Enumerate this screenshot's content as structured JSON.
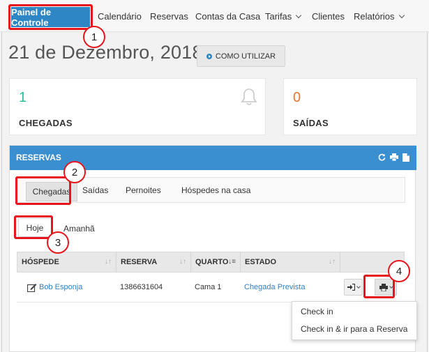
{
  "nav": {
    "active": "Painel de Controle",
    "items": [
      {
        "label": "Calendário"
      },
      {
        "label": "Reservas"
      },
      {
        "label": "Contas da Casa"
      },
      {
        "label": "Tarifas"
      },
      {
        "label": "Clientes"
      },
      {
        "label": "Relatórios"
      }
    ]
  },
  "header": {
    "date": "21 de Dezembro, 2018",
    "help_label": "COMO UTILIZAR"
  },
  "stats": [
    {
      "value": "1",
      "label": "CHEGADAS",
      "color": "#2bbf9a"
    },
    {
      "value": "0",
      "label": "SAÍDAS",
      "color": "#e3762f"
    }
  ],
  "panel": {
    "title": "RESERVAS",
    "tabs": [
      "Chegadas",
      "Saídas",
      "Pernoites",
      "Hóspedes na casa"
    ],
    "subtabs": [
      "Hoje",
      "Amanhã"
    ],
    "columns": [
      "HÓSPEDE",
      "RESERVA",
      "QUARTO",
      "ESTADO"
    ],
    "rows": [
      {
        "guest": "Bob Esponja",
        "reservation": "1386631604",
        "room": "Cama 1",
        "status": "Chegada Prevista"
      }
    ]
  },
  "dropdown": {
    "items": [
      "Check in",
      "Check in & ir para a Reserva"
    ]
  },
  "callouts": [
    "1",
    "2",
    "3",
    "4"
  ],
  "colors": {
    "accent": "#2f86c4",
    "panel_header": "#3a8fd0",
    "callout": "#e8141b",
    "link": "#2f7fc4"
  }
}
